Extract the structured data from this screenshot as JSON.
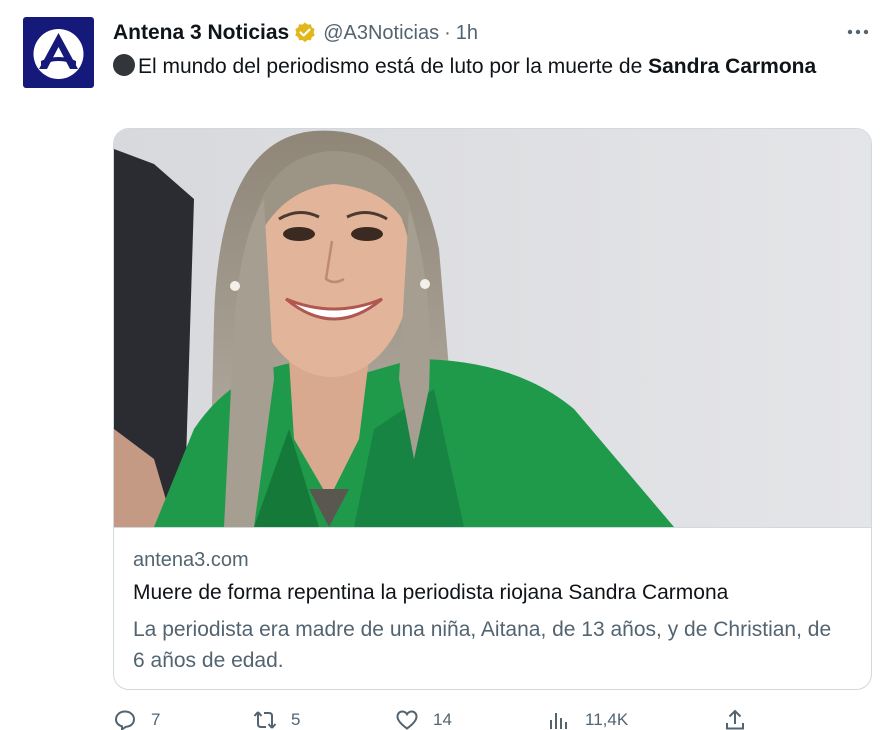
{
  "tweet": {
    "author": {
      "display_name": "Antena 3 Noticias",
      "handle": "@A3Noticias",
      "verified_badge": "gold-verified-icon",
      "avatar_icon": "antena3-logo",
      "avatar_color": "#15197a"
    },
    "separator": "·",
    "time": "1h",
    "more_icon": "more-icon",
    "text": {
      "emoji": "black-circle-icon",
      "prefix": "El mundo del periodismo está de luto por la muerte de ",
      "bold": "Sandra Carmona"
    },
    "card": {
      "image": "photo of smiling woman in green jacket",
      "domain": "antena3.com",
      "title": "Muere de forma repentina la periodista riojana Sandra Carmona",
      "description": "La periodista era madre de una niña, Aitana, de 13 años, y de Christian, de 6 años de edad."
    },
    "actions": {
      "replies": "7",
      "retweets": "5",
      "likes": "14",
      "views": "11,4K"
    }
  },
  "colors": {
    "text_primary": "#0f1419",
    "text_secondary": "#536471",
    "border": "#cfd9de",
    "verified_gold": "#e2b719"
  }
}
